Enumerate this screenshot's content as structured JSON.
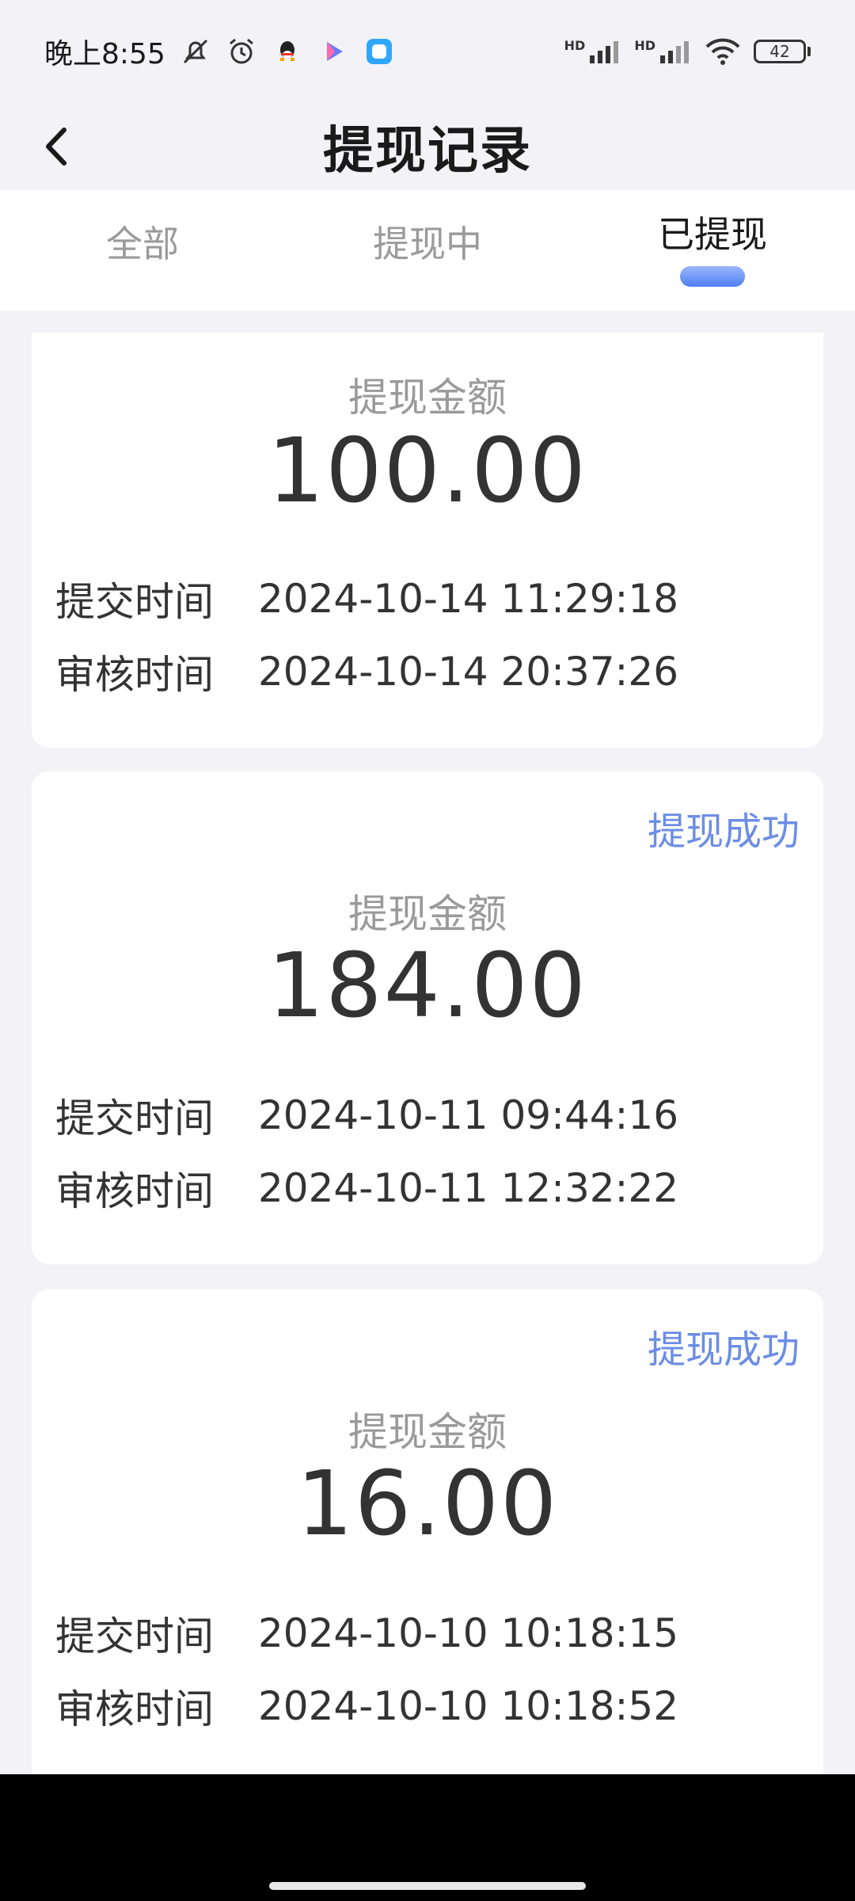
{
  "status_bar": {
    "time": "晚上8:55",
    "icons_left": [
      "mute-icon",
      "alarm-icon",
      "qq-icon",
      "video-app-icon",
      "chat-app-icon"
    ],
    "signal_1_label": "HD",
    "signal_2_label": "HD",
    "battery": "42"
  },
  "header": {
    "title": "提现记录",
    "back_icon": "chevron-left-icon"
  },
  "tabs": [
    {
      "label": "全部",
      "active": false
    },
    {
      "label": "提现中",
      "active": false
    },
    {
      "label": "已提现",
      "active": true
    }
  ],
  "records": [
    {
      "status": "",
      "amount_label": "提现金额",
      "amount": "100.00",
      "submit_label": "提交时间",
      "submit_time": "2024-10-14 11:29:18",
      "review_label": "审核时间",
      "review_time": "2024-10-14 20:37:26"
    },
    {
      "status": "提现成功",
      "amount_label": "提现金额",
      "amount": "184.00",
      "submit_label": "提交时间",
      "submit_time": "2024-10-11 09:44:16",
      "review_label": "审核时间",
      "review_time": "2024-10-11 12:32:22"
    },
    {
      "status": "提现成功",
      "amount_label": "提现金额",
      "amount": "16.00",
      "submit_label": "提交时间",
      "submit_time": "2024-10-10 10:18:15",
      "review_label": "审核时间",
      "review_time": "2024-10-10 10:18:52"
    }
  ],
  "colors": {
    "accent": "#6c8de6",
    "tab_indicator": "#4c7ef0",
    "background": "#f3f3f7"
  }
}
